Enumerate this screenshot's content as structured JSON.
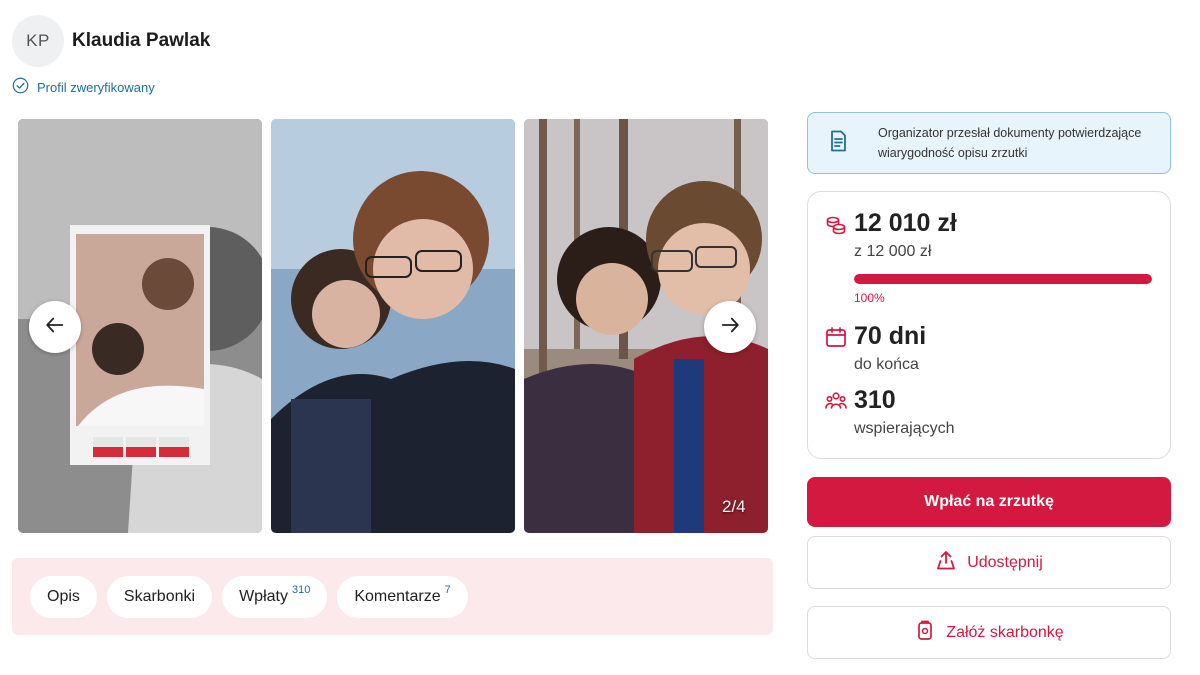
{
  "profile": {
    "initials": "KP",
    "name": "Klaudia Pawlak",
    "verified_label": "Profil zweryfikowany"
  },
  "gallery": {
    "counter": "2/4",
    "photos": [
      "photo-1",
      "photo-2",
      "photo-3"
    ],
    "prev_icon": "arrow-left-icon",
    "next_icon": "arrow-right-icon"
  },
  "tabs": [
    {
      "label": "Opis",
      "count": ""
    },
    {
      "label": "Skarbonki",
      "count": ""
    },
    {
      "label": "Wpłaty",
      "count": "310"
    },
    {
      "label": "Komentarze",
      "count": "7"
    }
  ],
  "notice": {
    "icon": "document-icon",
    "text": "Organizator przesłał dokumenty potwierdzające wiarygodność opisu zrzutki"
  },
  "stats": {
    "raised": "12 010 zł",
    "goal": "z 12 000 zł",
    "progress_percent": 100,
    "progress_label": "100%",
    "days": "70 dni",
    "days_label": "do końca",
    "supporters": "310",
    "supporters_label": "wspierających"
  },
  "actions": {
    "donate": "Wpłać na zrzutkę",
    "share": "Udostępnij",
    "piggy": "Załóż skarbonkę"
  },
  "colors": {
    "accent": "#d3193f",
    "link": "#1f6f97",
    "tabs_background": "#fce9ec",
    "notice_background": "#e8f4fb"
  }
}
